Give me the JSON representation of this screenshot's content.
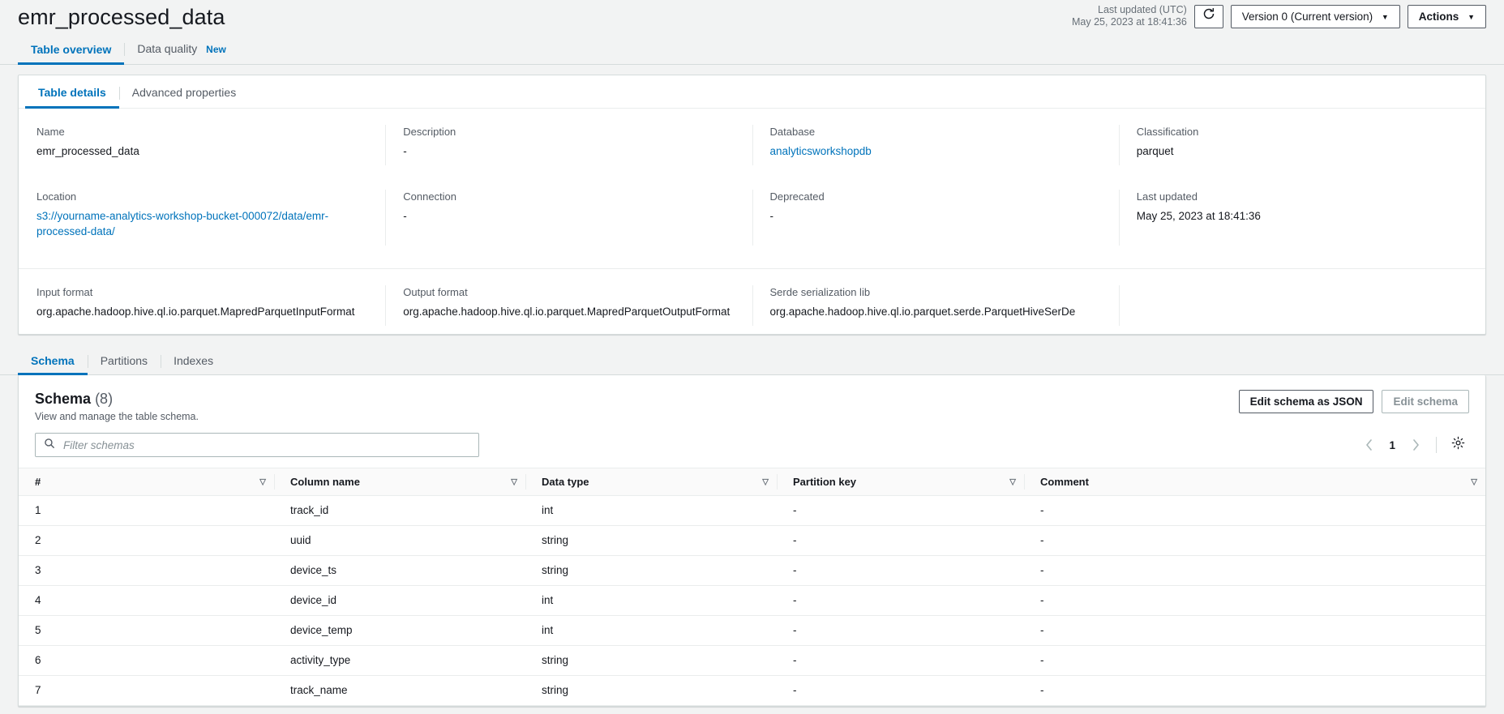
{
  "header": {
    "title": "emr_processed_data",
    "last_updated_label": "Last updated (UTC)",
    "last_updated_value": "May 25, 2023 at 18:41:36",
    "refresh_icon": "refresh-icon",
    "version_label": "Version 0 (Current version)",
    "actions_label": "Actions",
    "caret": "▼"
  },
  "outer_tabs": [
    {
      "label": "Table overview",
      "badge": ""
    },
    {
      "label": "Data quality",
      "badge": "New"
    }
  ],
  "inner_tabs": [
    {
      "label": "Table details"
    },
    {
      "label": "Advanced properties"
    }
  ],
  "details": {
    "row1": [
      {
        "label": "Name",
        "value": "emr_processed_data",
        "is_link": false
      },
      {
        "label": "Description",
        "value": "-",
        "is_link": false
      },
      {
        "label": "Database",
        "value": "analyticsworkshopdb",
        "is_link": true
      },
      {
        "label": "Classification",
        "value": "parquet",
        "is_link": false
      }
    ],
    "row2": [
      {
        "label": "Location",
        "value": "s3://yourname-analytics-workshop-bucket-000072/data/emr-processed-data/",
        "is_link": true
      },
      {
        "label": "Connection",
        "value": "-",
        "is_link": false
      },
      {
        "label": "Deprecated",
        "value": "-",
        "is_link": false
      },
      {
        "label": "Last updated",
        "value": "May 25, 2023 at 18:41:36",
        "is_link": false
      }
    ],
    "row3": [
      {
        "label": "Input format",
        "value": "org.apache.hadoop.hive.ql.io.parquet.MapredParquetInputFormat",
        "is_link": false
      },
      {
        "label": "Output format",
        "value": "org.apache.hadoop.hive.ql.io.parquet.MapredParquetOutputFormat",
        "is_link": false
      },
      {
        "label": "Serde serialization lib",
        "value": "org.apache.hadoop.hive.ql.io.parquet.serde.ParquetHiveSerDe",
        "is_link": false
      }
    ]
  },
  "schema_tabs": [
    {
      "label": "Schema"
    },
    {
      "label": "Partitions"
    },
    {
      "label": "Indexes"
    }
  ],
  "schema": {
    "title": "Schema",
    "count": "(8)",
    "subtitle": "View and manage the table schema.",
    "edit_json_label": "Edit schema as JSON",
    "edit_label": "Edit schema",
    "filter_placeholder": "Filter schemas",
    "search_icon": "search-icon",
    "page_number": "1",
    "prev_icon": "chevron-left-icon",
    "next_icon": "chevron-right-icon",
    "settings_icon": "gear-icon",
    "columns": [
      "#",
      "Column name",
      "Data type",
      "Partition key",
      "Comment"
    ],
    "sort_icon": "▽",
    "rows": [
      {
        "num": "1",
        "name": "track_id",
        "type": "int",
        "partition": "-",
        "comment": "-"
      },
      {
        "num": "2",
        "name": "uuid",
        "type": "string",
        "partition": "-",
        "comment": "-"
      },
      {
        "num": "3",
        "name": "device_ts",
        "type": "string",
        "partition": "-",
        "comment": "-"
      },
      {
        "num": "4",
        "name": "device_id",
        "type": "int",
        "partition": "-",
        "comment": "-"
      },
      {
        "num": "5",
        "name": "device_temp",
        "type": "int",
        "partition": "-",
        "comment": "-"
      },
      {
        "num": "6",
        "name": "activity_type",
        "type": "string",
        "partition": "-",
        "comment": "-"
      },
      {
        "num": "7",
        "name": "track_name",
        "type": "string",
        "partition": "-",
        "comment": "-"
      }
    ]
  },
  "colors": {
    "accent": "#0073bb",
    "background": "#f2f3f3",
    "border": "#d5dbdb",
    "text": "#16191f",
    "muted": "#545b64"
  }
}
